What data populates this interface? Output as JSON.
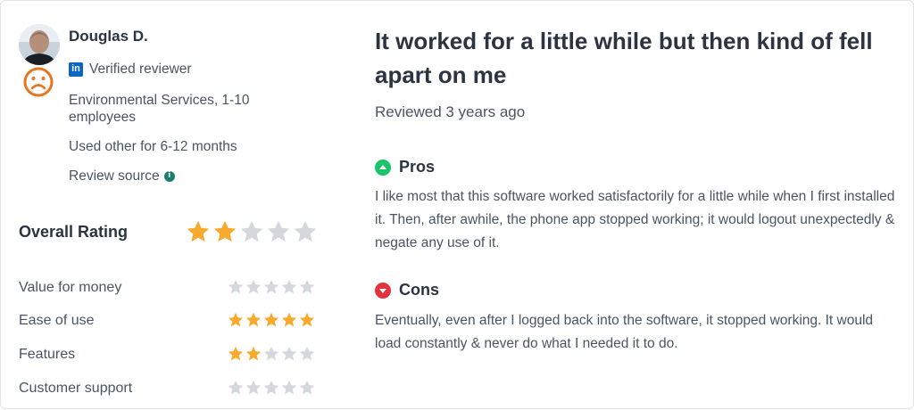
{
  "reviewer": {
    "name": "Douglas D.",
    "verified_label": "Verified reviewer",
    "company": "Environmental Services, 1-10 employees",
    "usage": "Used other for 6-12 months",
    "source_label": "Review source"
  },
  "overall": {
    "label": "Overall Rating",
    "stars": 2,
    "max": 5
  },
  "ratings": [
    {
      "label": "Value for money",
      "stars": 0
    },
    {
      "label": "Ease of use",
      "stars": 5
    },
    {
      "label": "Features",
      "stars": 2
    },
    {
      "label": "Customer support",
      "stars": 0
    }
  ],
  "review": {
    "title": "It worked for a little while but then kind of fell apart on me",
    "reviewed": "Reviewed 3 years ago",
    "pros_heading": "Pros",
    "pros_text": "I like most that this software worked satisfactorily for a little while when I first installed it. Then, after awhile, the phone app stopped working; it would logout unexpectedly & negate any use of it.",
    "cons_heading": "Cons",
    "cons_text": "Eventually, even after I logged back into the software, it stopped working. It would load constantly & never do what I needed it to do."
  },
  "colors": {
    "star_filled": "#f6ab2f",
    "star_empty": "#d4d7dc",
    "pros": "#1bc46a",
    "cons": "#e1343d",
    "sentiment": "#e8761f"
  },
  "icons": {
    "linkedin": "linkedin-icon",
    "info": "info-icon",
    "sentiment": "sad-face-icon"
  }
}
